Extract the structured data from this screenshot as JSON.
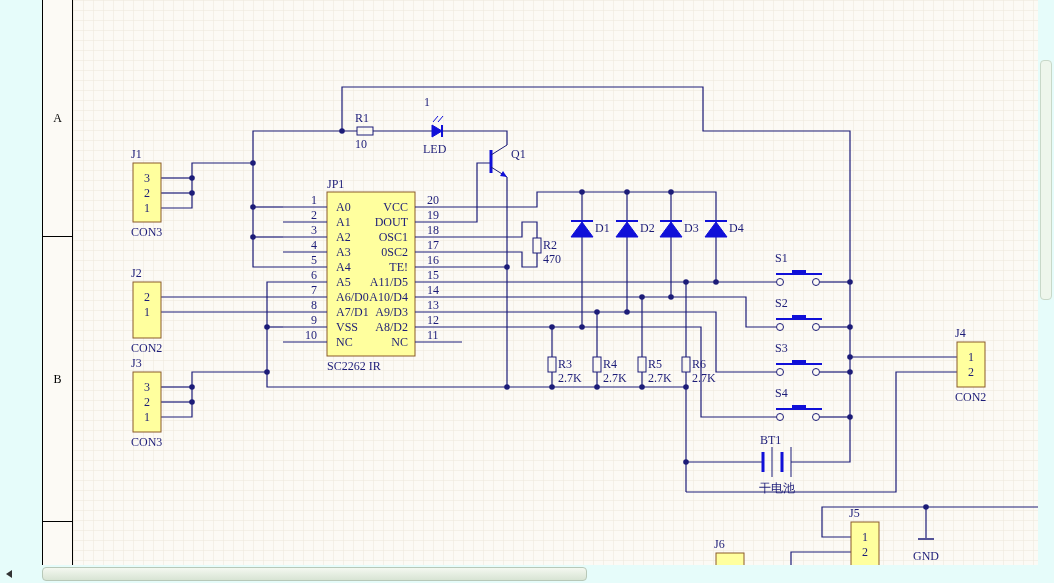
{
  "sheet_border": {
    "zones": [
      "A",
      "B"
    ]
  },
  "components": [
    {
      "kind": "connector",
      "designator": "J1",
      "value": "CON3",
      "pins": [
        "3",
        "2",
        "1"
      ]
    },
    {
      "kind": "connector",
      "designator": "J2",
      "value": "CON2",
      "pins": [
        "2",
        "1"
      ]
    },
    {
      "kind": "connector",
      "designator": "J3",
      "value": "CON3",
      "pins": [
        "3",
        "2",
        "1"
      ]
    },
    {
      "kind": "resistor",
      "designator": "R1",
      "value": "10"
    },
    {
      "kind": "led",
      "designator": "1",
      "value": "LED"
    },
    {
      "kind": "transistor",
      "designator": "Q1"
    },
    {
      "kind": "ic",
      "designator": "JP1",
      "value": "SC2262 IR",
      "left_pins": [
        {
          "number": "1",
          "name": "A0"
        },
        {
          "number": "2",
          "name": "A1"
        },
        {
          "number": "3",
          "name": "A2"
        },
        {
          "number": "4",
          "name": "A3"
        },
        {
          "number": "5",
          "name": "A4"
        },
        {
          "number": "6",
          "name": "A5"
        },
        {
          "number": "7",
          "name": "A6/D0"
        },
        {
          "number": "8",
          "name": "A7/D1"
        },
        {
          "number": "9",
          "name": "VSS"
        },
        {
          "number": "10",
          "name": "NC"
        }
      ],
      "right_pins": [
        {
          "number": "20",
          "name": "VCC"
        },
        {
          "number": "19",
          "name": "DOUT"
        },
        {
          "number": "18",
          "name": "OSC1"
        },
        {
          "number": "17",
          "name": "0SC2"
        },
        {
          "number": "16",
          "name": "TE!"
        },
        {
          "number": "15",
          "name": "A11/D5"
        },
        {
          "number": "14",
          "name": "A10/D4"
        },
        {
          "number": "13",
          "name": "A9/D3"
        },
        {
          "number": "12",
          "name": "A8/D2"
        },
        {
          "number": "11",
          "name": "NC"
        }
      ]
    },
    {
      "kind": "resistor",
      "designator": "R2",
      "value": "470"
    },
    {
      "kind": "diode",
      "designator": "D1"
    },
    {
      "kind": "diode",
      "designator": "D2"
    },
    {
      "kind": "diode",
      "designator": "D3"
    },
    {
      "kind": "diode",
      "designator": "D4"
    },
    {
      "kind": "resistor",
      "designator": "R3",
      "value": "2.7K"
    },
    {
      "kind": "resistor",
      "designator": "R4",
      "value": "2.7K"
    },
    {
      "kind": "resistor",
      "designator": "R5",
      "value": "2.7K"
    },
    {
      "kind": "resistor",
      "designator": "R6",
      "value": "2.7K"
    },
    {
      "kind": "switch",
      "designator": "S1"
    },
    {
      "kind": "switch",
      "designator": "S2"
    },
    {
      "kind": "switch",
      "designator": "S3"
    },
    {
      "kind": "switch",
      "designator": "S4"
    },
    {
      "kind": "battery",
      "designator": "BT1",
      "value": "干电池"
    },
    {
      "kind": "connector",
      "designator": "J4",
      "value": "CON2",
      "pins": [
        "1",
        "2"
      ]
    },
    {
      "kind": "connector",
      "designator": "J5",
      "pins": [
        "1",
        "2"
      ]
    },
    {
      "kind": "connector",
      "designator": "J6"
    }
  ],
  "net_labels": [
    "GND"
  ]
}
